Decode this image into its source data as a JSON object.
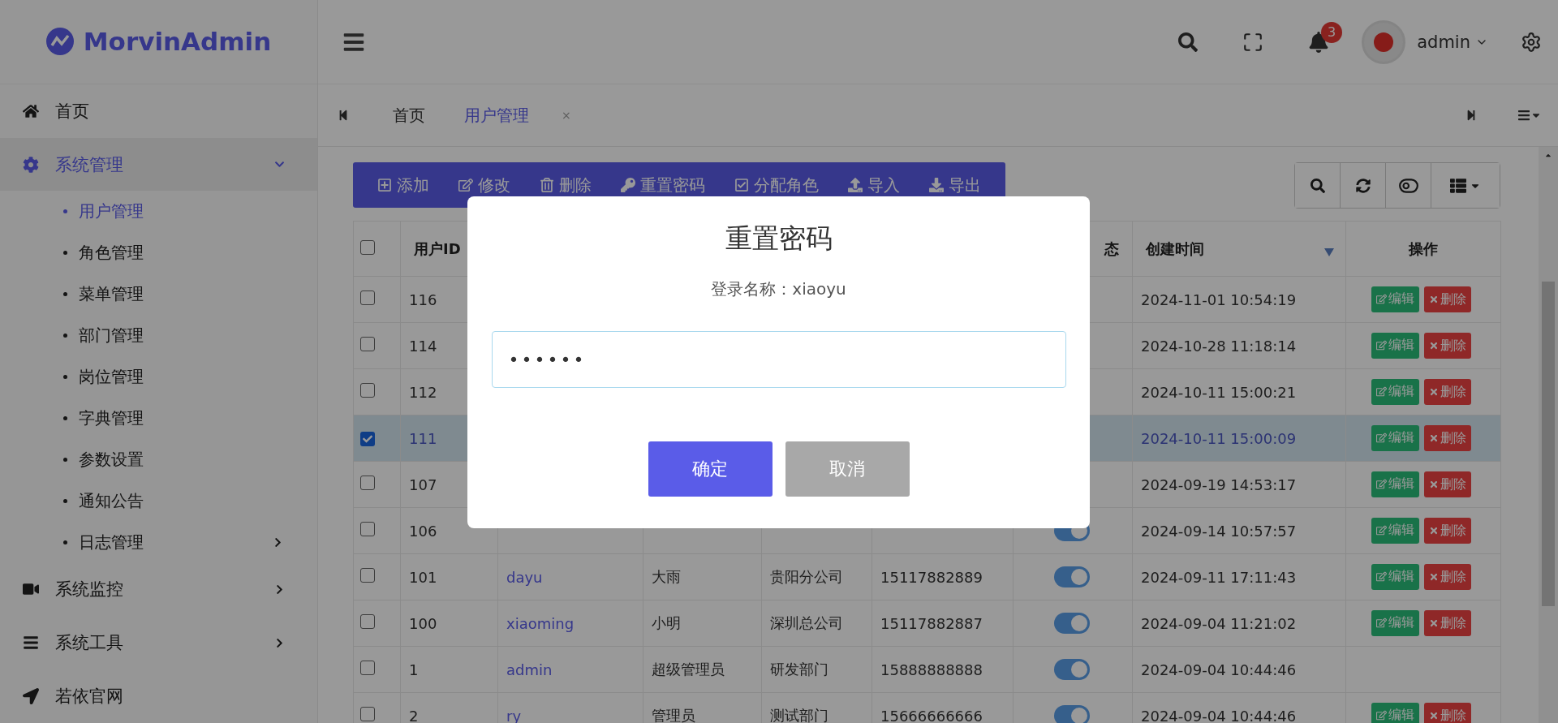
{
  "brand": {
    "name": "MorvinAdmin"
  },
  "header": {
    "notifications": "3",
    "user": "admin"
  },
  "sidebar": {
    "items": [
      {
        "label": "首页",
        "selected": false,
        "expandable": false
      },
      {
        "label": "系统管理",
        "selected": true,
        "expandable": true,
        "expanded": true,
        "children": [
          {
            "label": "用户管理",
            "selected": true,
            "expandable": false
          },
          {
            "label": "角色管理",
            "selected": false,
            "expandable": false
          },
          {
            "label": "菜单管理",
            "selected": false,
            "expandable": false
          },
          {
            "label": "部门管理",
            "selected": false,
            "expandable": false
          },
          {
            "label": "岗位管理",
            "selected": false,
            "expandable": false
          },
          {
            "label": "字典管理",
            "selected": false,
            "expandable": false
          },
          {
            "label": "参数设置",
            "selected": false,
            "expandable": false
          },
          {
            "label": "通知公告",
            "selected": false,
            "expandable": false
          },
          {
            "label": "日志管理",
            "selected": false,
            "expandable": true
          }
        ]
      },
      {
        "label": "系统监控",
        "selected": false,
        "expandable": true,
        "expanded": false
      },
      {
        "label": "系统工具",
        "selected": false,
        "expandable": true,
        "expanded": false
      },
      {
        "label": "若依官网",
        "selected": false,
        "expandable": false
      }
    ]
  },
  "tabs": [
    {
      "label": "首页",
      "selected": false
    },
    {
      "label": "用户管理",
      "selected": true,
      "close": "×"
    }
  ],
  "toolbar": {
    "buttons": [
      "添加",
      "修改",
      "删除",
      "重置密码",
      "分配角色",
      "导入",
      "导出"
    ]
  },
  "table": {
    "all_selected": false,
    "columns": {
      "user_id": "用户ID",
      "status": "态",
      "created": "创建时间",
      "actions": "操作"
    },
    "sort": {
      "descending": true
    },
    "rows": [
      {
        "id": "116",
        "created": "2024-11-01 10:54:19",
        "selected": false,
        "actions": [
          "编辑",
          "删除"
        ]
      },
      {
        "id": "114",
        "created": "2024-10-28 11:18:14",
        "selected": false,
        "actions": [
          "编辑",
          "删除"
        ]
      },
      {
        "id": "112",
        "created": "2024-10-11 15:00:21",
        "selected": false,
        "actions": [
          "编辑",
          "删除"
        ]
      },
      {
        "id": "111",
        "created": "2024-10-11 15:00:09",
        "selected": true,
        "actions": [
          "编辑",
          "删除"
        ]
      },
      {
        "id": "107",
        "created": "2024-09-19 14:53:17",
        "selected": false,
        "actions": [
          "编辑",
          "删除"
        ]
      },
      {
        "id": "106",
        "enabled": true,
        "created": "2024-09-14 10:57:57",
        "selected": false,
        "actions": [
          "编辑",
          "删除"
        ]
      },
      {
        "id": "101",
        "login": "dayu",
        "name": "大雨",
        "dept": "贵阳分公司",
        "phone": "15117882889",
        "enabled": true,
        "created": "2024-09-11 17:11:43",
        "selected": false,
        "actions": [
          "编辑",
          "删除"
        ]
      },
      {
        "id": "100",
        "login": "xiaoming",
        "name": "小明",
        "dept": "深圳总公司",
        "phone": "15117882887",
        "enabled": true,
        "created": "2024-09-04 11:21:02",
        "selected": false,
        "actions": [
          "编辑",
          "删除"
        ]
      },
      {
        "id": "1",
        "login": "admin",
        "name": "超级管理员",
        "dept": "研发部门",
        "phone": "15888888888",
        "enabled": true,
        "created": "2024-09-04 10:44:46",
        "selected": false
      },
      {
        "id": "2",
        "login": "ry",
        "name": "管理员",
        "dept": "测试部门",
        "phone": "15666666666",
        "enabled": true,
        "created": "2024-09-04 10:44:46",
        "selected": false,
        "actions": [
          "编辑",
          "删除"
        ]
      }
    ]
  },
  "modal": {
    "title": "重置密码",
    "subtitle": "登录名称：xiaoyu",
    "password": "••••••",
    "buttons": [
      {
        "label": "确定",
        "kind": "primary"
      },
      {
        "label": "取消",
        "kind": "secondary"
      }
    ]
  }
}
